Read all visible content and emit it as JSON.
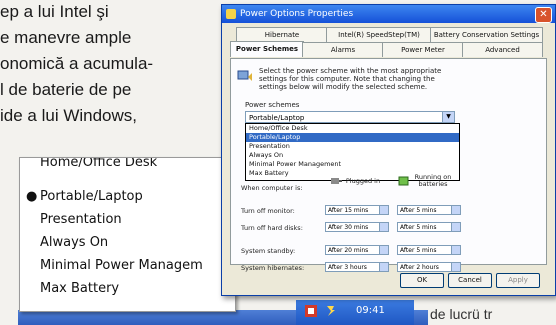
{
  "article": {
    "lines": [
      "ep a lui Intel şi",
      "e manevre ample",
      "onomică a acumula-",
      "l de baterie de pe",
      "ide a lui Windows,"
    ],
    "bottom_right": "de lucrü tr"
  },
  "zoom_list": {
    "items": [
      {
        "label": "Home/Office Desk",
        "selected": false
      },
      {
        "label": "Portable/Laptop",
        "selected": true
      },
      {
        "label": "Presentation",
        "selected": false
      },
      {
        "label": "Always On",
        "selected": false
      },
      {
        "label": "Minimal Power Managem",
        "selected": false
      },
      {
        "label": "Max Battery",
        "selected": false
      }
    ]
  },
  "dialog": {
    "title": "Power Options Properties",
    "tabs_row1": [
      "Hibernate",
      "Intel(R) SpeedStep(TM)",
      "Battery Conservation Settings"
    ],
    "tabs_row2": [
      "Power Schemes",
      "Alarms",
      "Power Meter",
      "Advanced"
    ],
    "description": "Select the power scheme with the most appropriate settings for this computer. Note that changing the settings below will modify the selected scheme.",
    "scheme_label": "Power schemes",
    "scheme_value": "Portable/Laptop",
    "dropdown_items": [
      {
        "label": "Home/Office Desk",
        "selected": false
      },
      {
        "label": "Portable/Laptop",
        "selected": true
      },
      {
        "label": "Presentation",
        "selected": false
      },
      {
        "label": "Always On",
        "selected": false
      },
      {
        "label": "Minimal Power Management",
        "selected": false
      },
      {
        "label": "Max Battery",
        "selected": false
      }
    ],
    "settings_title": "When computer is:",
    "col_plugged": "Plugged in",
    "col_battery": "Running on batteries",
    "rows": [
      {
        "label": "Turn off monitor:",
        "plugged": "After 15 mins",
        "battery": "After 5 mins"
      },
      {
        "label": "Turn off hard disks:",
        "plugged": "After 30 mins",
        "battery": "After 5 mins"
      },
      {
        "label": "System standby:",
        "plugged": "After 20 mins",
        "battery": "After 5 mins"
      },
      {
        "label": "System hibernates:",
        "plugged": "After 3 hours",
        "battery": "After 2 hours"
      }
    ],
    "buttons": {
      "ok": "OK",
      "cancel": "Cancel",
      "apply": "Apply"
    }
  },
  "taskbar": {
    "clock": "09:41"
  }
}
